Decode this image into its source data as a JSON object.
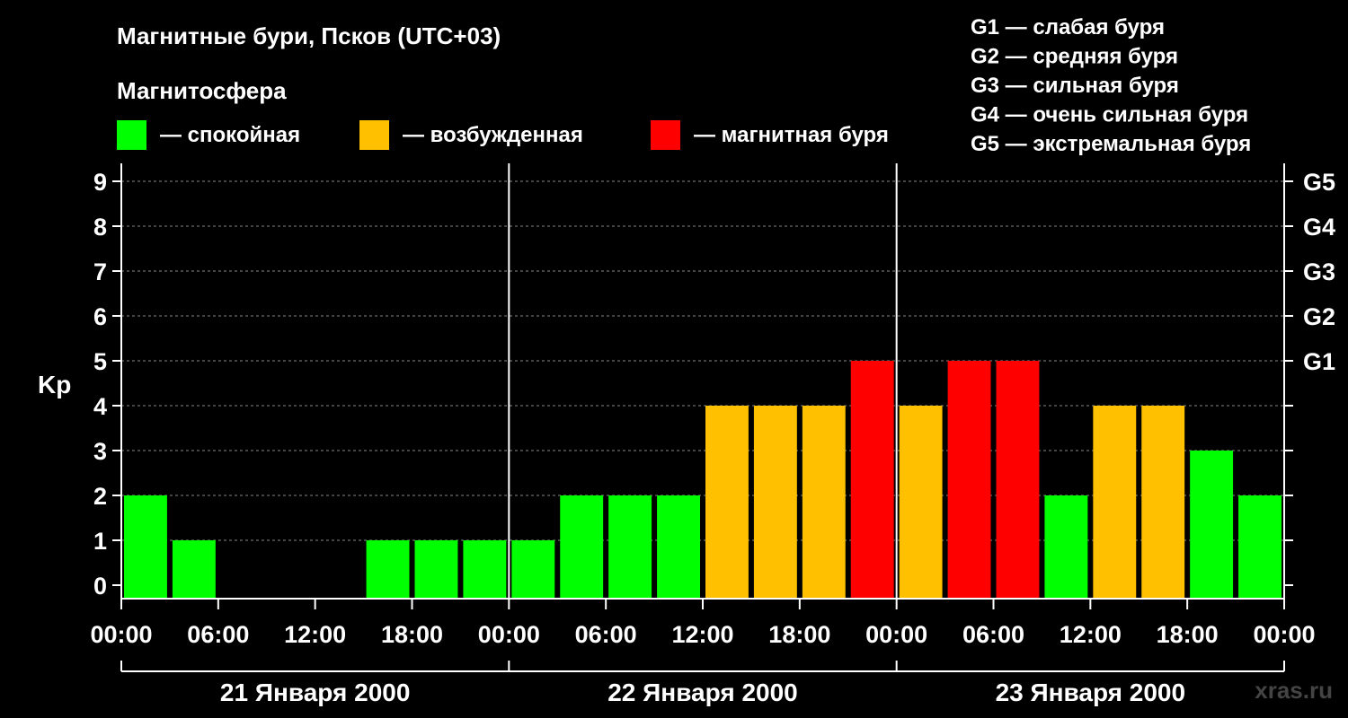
{
  "chart_data": {
    "type": "bar",
    "title": "Магнитные бури, Псков (UTC+03)",
    "legend_title": "Магнитосфера",
    "legend": [
      {
        "label": "— спокойная",
        "color": "#00ff00"
      },
      {
        "label": "— возбужденная",
        "color": "#ffc000"
      },
      {
        "label": "— магнитная буря",
        "color": "#ff0000"
      }
    ],
    "storm_scale": [
      "G1 — слабая буря",
      "G2 — средняя буря",
      "G3 — сильная буря",
      "G4 — очень сильная буря",
      "G5 — экстремальная буря"
    ],
    "ylabel": "Kp",
    "ylim": [
      0,
      9
    ],
    "y_ticks": [
      "0",
      "1",
      "2",
      "3",
      "4",
      "5",
      "6",
      "7",
      "8",
      "9"
    ],
    "right_ticks": [
      {
        "value": 5,
        "label": "G1"
      },
      {
        "value": 6,
        "label": "G2"
      },
      {
        "value": 7,
        "label": "G3"
      },
      {
        "value": 8,
        "label": "G4"
      },
      {
        "value": 9,
        "label": "G5"
      }
    ],
    "x_tick_labels": [
      "00:00",
      "06:00",
      "12:00",
      "18:00",
      "00:00",
      "06:00",
      "12:00",
      "18:00",
      "00:00",
      "06:00",
      "12:00",
      "18:00",
      "00:00"
    ],
    "days": [
      "21 Января 2000",
      "22 Января 2000",
      "23 Января 2000"
    ],
    "values": [
      2,
      1,
      0,
      0,
      0,
      1,
      1,
      1,
      1,
      2,
      2,
      2,
      4,
      4,
      4,
      5,
      4,
      5,
      5,
      2,
      4,
      4,
      3,
      2
    ],
    "status": [
      "спокойная",
      "спокойная",
      "спокойная",
      "спокойная",
      "спокойная",
      "спокойная",
      "спокойная",
      "спокойная",
      "спокойная",
      "спокойная",
      "спокойная",
      "спокойная",
      "возбужденная",
      "возбужденная",
      "возбужденная",
      "магнитная буря",
      "возбужденная",
      "магнитная буря",
      "магнитная буря",
      "спокойная",
      "возбужденная",
      "возбужденная",
      "спокойная",
      "спокойная"
    ],
    "colors": {
      "спокойная": "#00ff00",
      "возбужденная": "#ffc000",
      "магнитная буря": "#ff0000"
    },
    "grid": true,
    "legend_position": "top"
  },
  "watermark": "xras.ru"
}
